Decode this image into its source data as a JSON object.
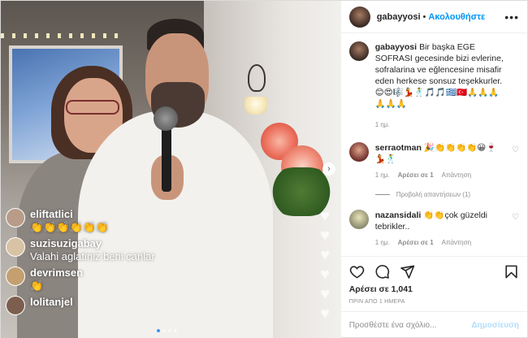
{
  "post": {
    "username": "gabayyosi",
    "separator": "•",
    "follow_label": "Ακολουθήστε",
    "more_label": "•••",
    "caption": {
      "username": "gabayyosi",
      "text": "Bir başka EGE SOFRASI gecesinde bizi evlerine, sofralarina ve eğlencesine misafir eden herkese sonsuz teşekkurler.",
      "emojis": "😊😍🎼💃🕺🎵🎵🇬🇷🇹🇷🙏🙏🙏 🙏🙏🙏",
      "age": "1 ημ."
    },
    "comments": [
      {
        "username": "serraotman",
        "text": "🎉👏👏👏👏😀🍷 💃🕺",
        "age": "1 ημ.",
        "likes_label": "Αρέσει σε 1",
        "reply_label": "Απάντηση",
        "view_replies": "Προβολή απαντήσεων (1)"
      },
      {
        "username": "nazansidali",
        "text": "👏👏çok güzeldi tebrikler..",
        "age": "1 ημ.",
        "likes_label": "Αρέσει σε 1",
        "reply_label": "Απάντηση"
      }
    ],
    "likes": "Αρέσει σε 1,041",
    "timestamp": "ΠΡΙΝ ΑΠΟ 1 ΗΜΕΡΑ",
    "add_comment_placeholder": "Προσθέστε ένα σχόλιο...",
    "post_button": "Δημοσίευση"
  },
  "media": {
    "next_icon": "›",
    "live_comments": [
      {
        "username": "eliftatlici",
        "text": "👏👏👏👏👏👏"
      },
      {
        "username": "suzisuzigabay",
        "text": "Valahi aglatiniz beni canlar"
      },
      {
        "username": "devrimsen",
        "text": "👏"
      },
      {
        "username": "lolitanjel",
        "text": ""
      }
    ],
    "carousel_count": 4,
    "carousel_active": 1
  },
  "icons": {
    "more": "more-options-icon",
    "heart": "heart-icon",
    "comment": "comment-icon",
    "share": "share-icon",
    "bookmark": "bookmark-icon",
    "next": "chevron-right-icon"
  },
  "colors": {
    "follow_blue": "#0095f6",
    "post_disabled": "#b2dffc",
    "muted_text": "#8e8e8e"
  }
}
